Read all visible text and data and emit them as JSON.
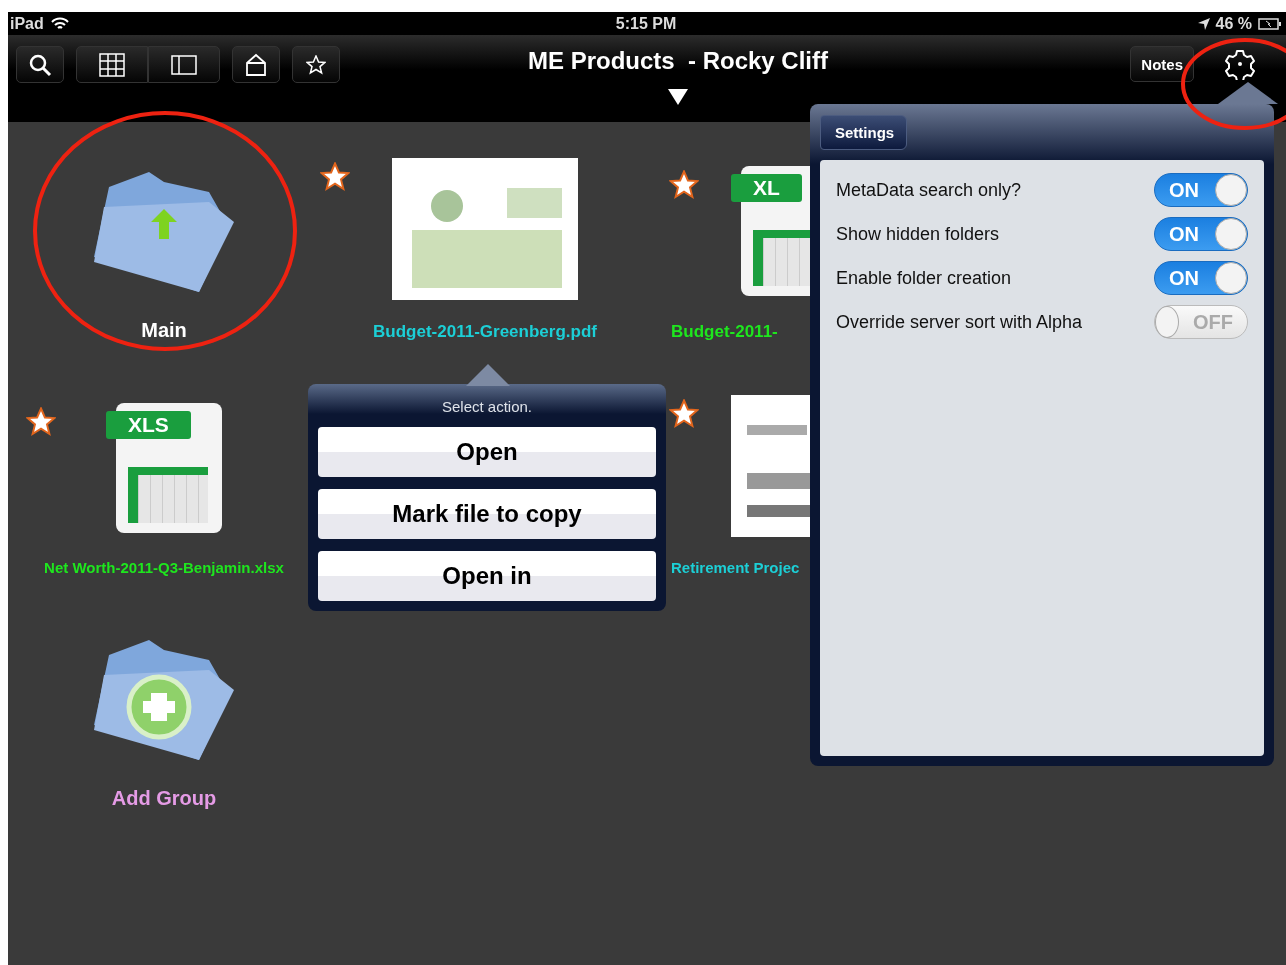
{
  "status_bar": {
    "device": "iPad",
    "time": "5:15 PM",
    "battery": "46 %"
  },
  "toolbar": {
    "title": "ME Products  - Rocky Cliff",
    "notes_button": "Notes"
  },
  "items": [
    {
      "kind": "folder-up",
      "label": "Main",
      "starred": false
    },
    {
      "kind": "pdf",
      "label": "Budget-2011-Greenberg.pdf",
      "starred": true
    },
    {
      "kind": "xls",
      "label": "Budget-2011-",
      "starred": true,
      "badge": "XL"
    },
    {
      "kind": "xls",
      "label": "Net Worth-2011-Q3-Benjamin.xlsx",
      "starred": true,
      "badge": "XLS"
    },
    {
      "kind": "doc",
      "label": "Retirement Projec",
      "starred": true
    },
    {
      "kind": "folder-add",
      "label": "Add Group",
      "starred": false
    }
  ],
  "action_popover": {
    "title": "Select action.",
    "buttons": [
      "Open",
      "Mark file to copy",
      "Open in"
    ]
  },
  "settings": {
    "title": "Settings",
    "rows": [
      {
        "label": "MetaData search only?",
        "on": true,
        "state_label": "ON"
      },
      {
        "label": "Show hidden folders",
        "on": true,
        "state_label": "ON"
      },
      {
        "label": "Enable folder creation",
        "on": true,
        "state_label": "ON"
      },
      {
        "label": "Override server sort with Alpha",
        "on": false,
        "state_label": "OFF"
      }
    ]
  }
}
